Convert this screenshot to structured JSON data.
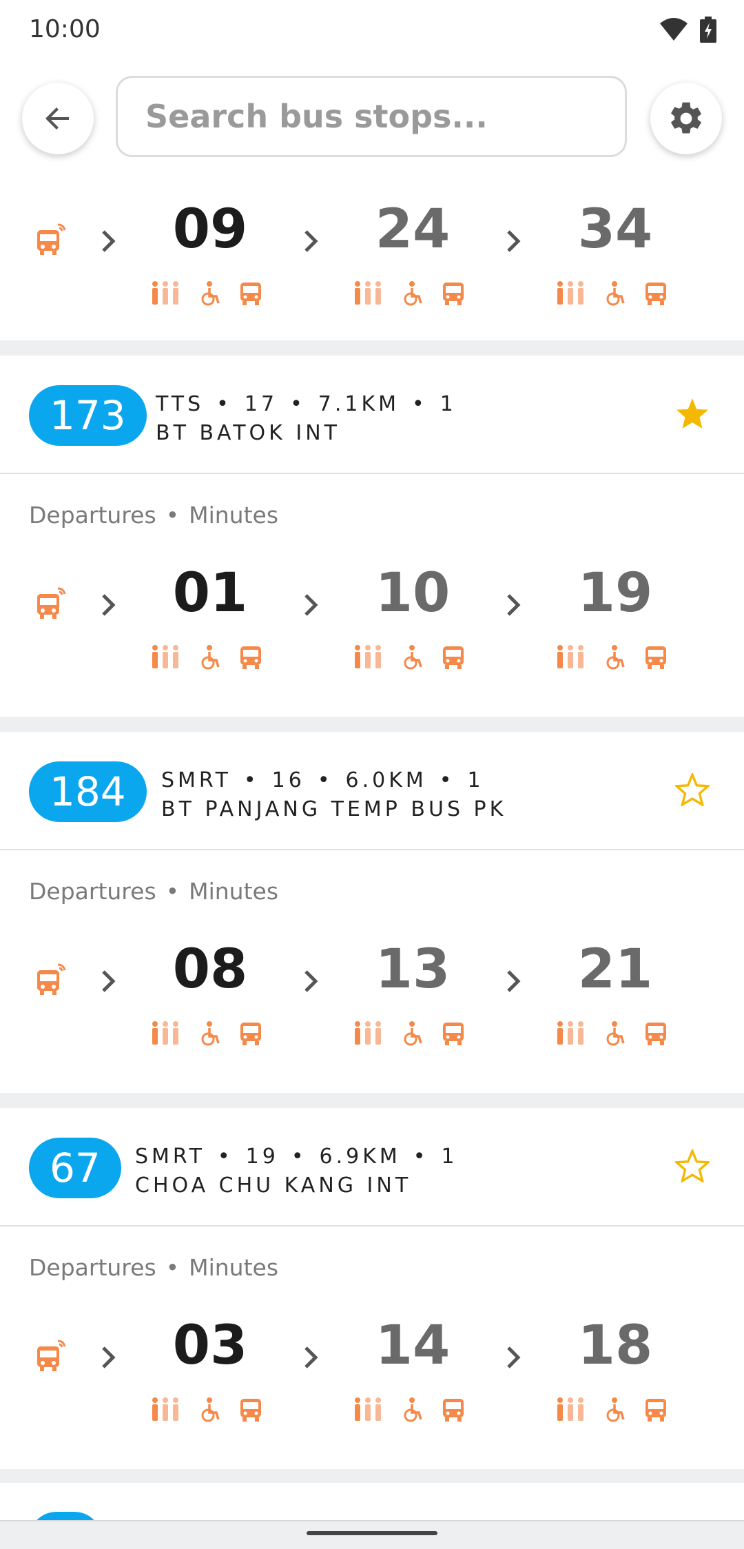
{
  "status": {
    "time": "10:00"
  },
  "search": {
    "placeholder": "Search bus stops..."
  },
  "colors": {
    "accent_blue": "#0aa7ef",
    "accent_orange": "#f5894a",
    "star_gold": "#f5b800"
  },
  "top_arrivals": {
    "first": "09",
    "second": "24",
    "third": "34"
  },
  "services": [
    {
      "route": "173",
      "meta_operator": "TTS",
      "meta_stops": "17",
      "meta_distance": "7.1KM",
      "meta_dir": "1",
      "destination": "BT BATOK INT",
      "favorite": true,
      "dep_label": "Departures",
      "unit_label": "Minutes",
      "arrivals": [
        "01",
        "10",
        "19"
      ]
    },
    {
      "route": "184",
      "meta_operator": "SMRT",
      "meta_stops": "16",
      "meta_distance": "6.0KM",
      "meta_dir": "1",
      "destination": "BT PANJANG TEMP BUS PK",
      "favorite": false,
      "dep_label": "Departures",
      "unit_label": "Minutes",
      "arrivals": [
        "08",
        "13",
        "21"
      ]
    },
    {
      "route": "67",
      "meta_operator": "SMRT",
      "meta_stops": "19",
      "meta_distance": "6.9KM",
      "meta_dir": "1",
      "destination": "CHOA CHU KANG INT",
      "favorite": false,
      "dep_label": "Departures",
      "unit_label": "Minutes",
      "arrivals": [
        "03",
        "14",
        "18"
      ]
    }
  ]
}
